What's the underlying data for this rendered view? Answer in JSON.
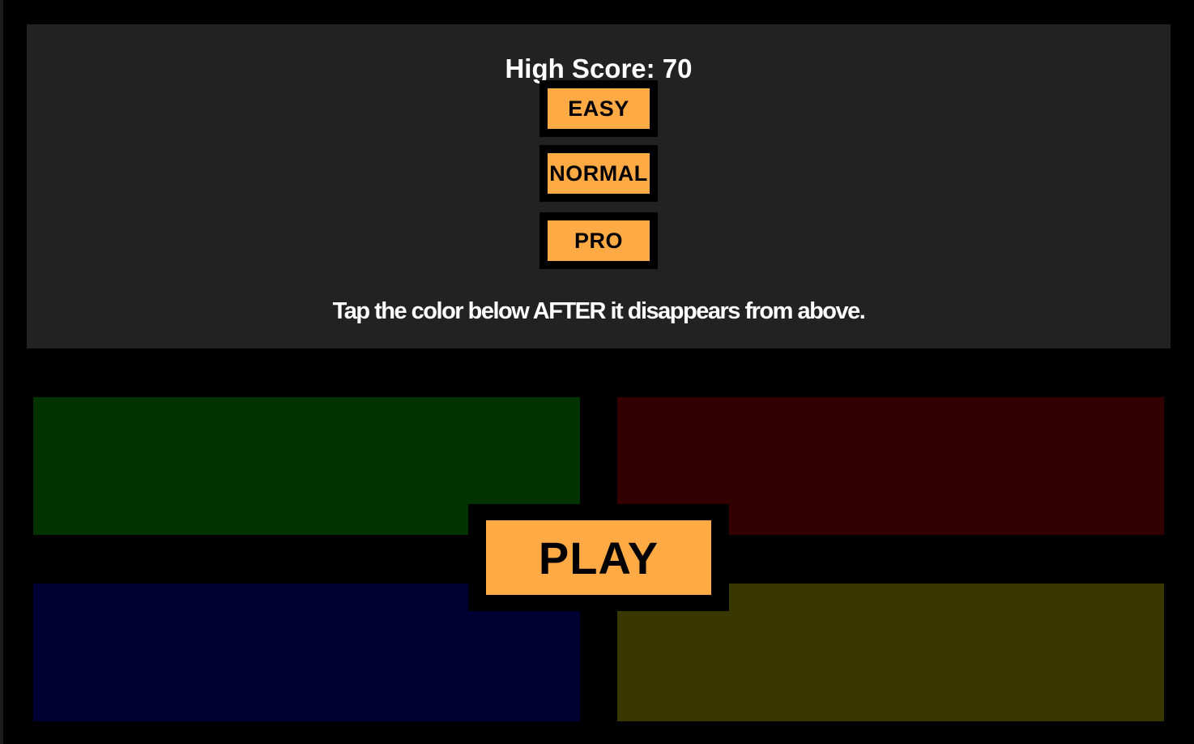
{
  "header": {
    "high_score_text": "High Score: 70"
  },
  "difficulty": {
    "buttons": [
      {
        "label": "EASY"
      },
      {
        "label": "NORMAL"
      },
      {
        "label": "PRO"
      }
    ]
  },
  "instructions": "Tap the color below AFTER it disappears from above.",
  "tiles": {
    "green": {
      "color": "#003300"
    },
    "red": {
      "color": "#330000"
    },
    "blue": {
      "color": "#000033"
    },
    "yellow": {
      "color": "#393800"
    }
  },
  "play_button": {
    "label": "PLAY",
    "color": "#ffaa44"
  },
  "theme": {
    "accent": "#ffaa44",
    "panel_bg": "#222222",
    "background": "#000000"
  }
}
